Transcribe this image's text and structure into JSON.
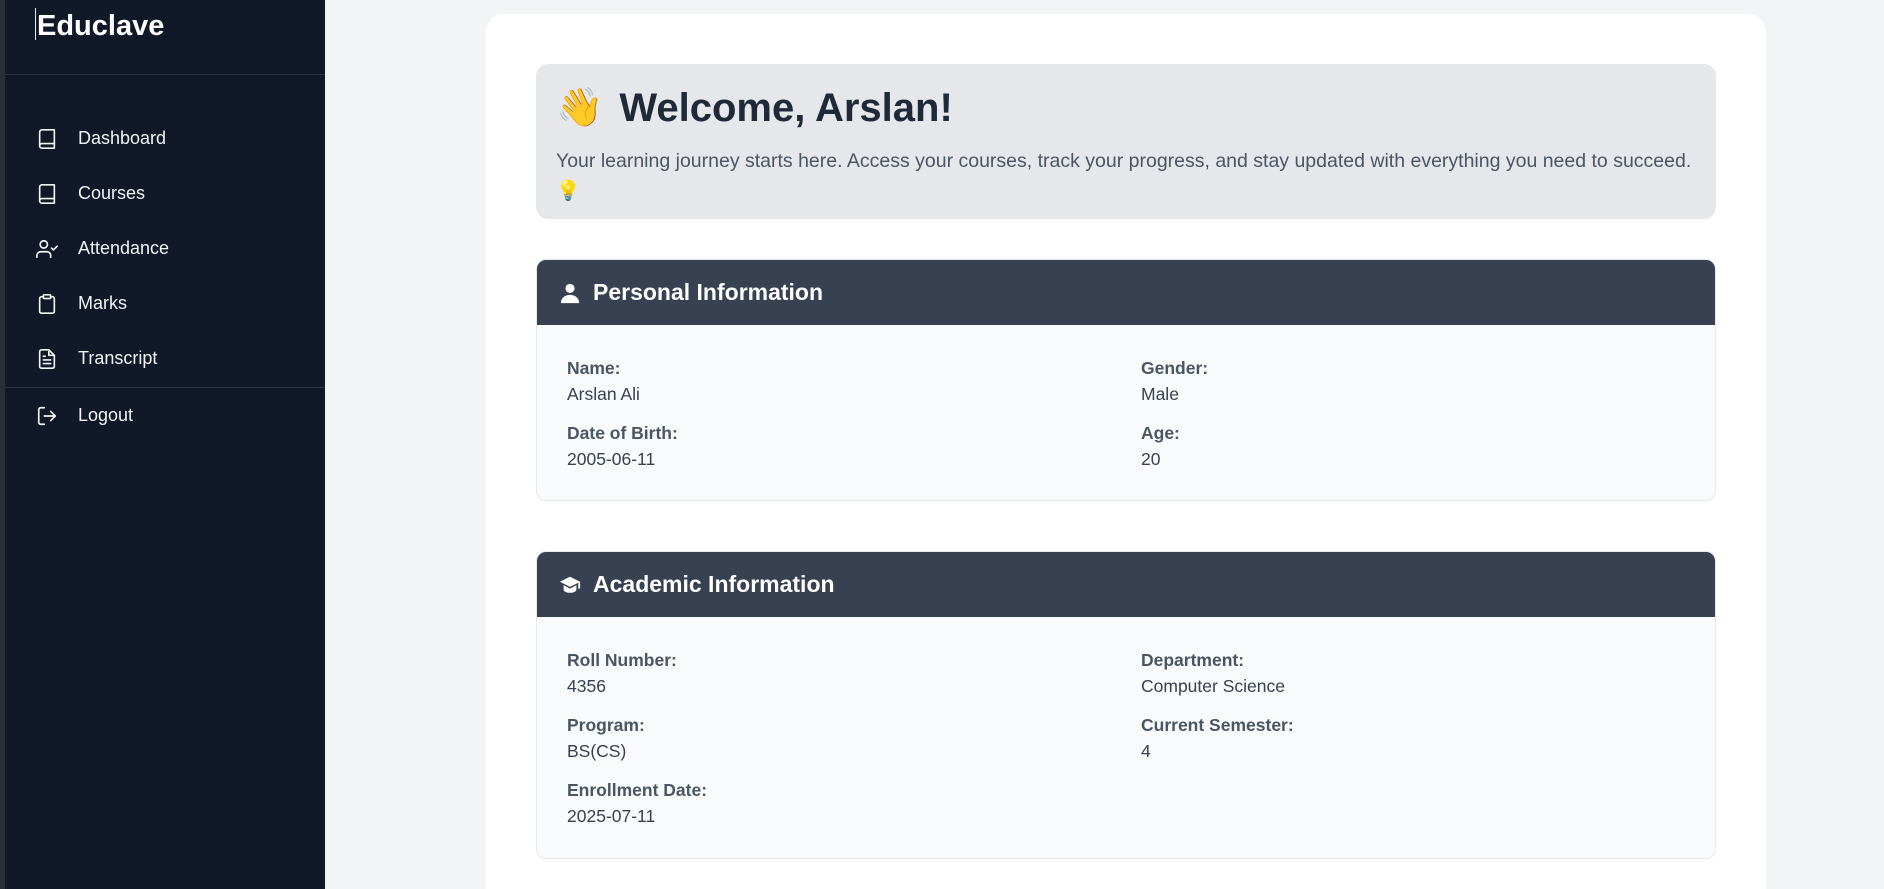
{
  "app": {
    "brand": "Educlave"
  },
  "sidebar": {
    "items": [
      {
        "label": "Dashboard",
        "icon": "book-icon"
      },
      {
        "label": "Courses",
        "icon": "book-icon"
      },
      {
        "label": "Attendance",
        "icon": "user-check-icon"
      },
      {
        "label": "Marks",
        "icon": "clipboard-icon"
      },
      {
        "label": "Transcript",
        "icon": "file-text-icon"
      }
    ],
    "logout": {
      "label": "Logout",
      "icon": "logout-icon"
    }
  },
  "welcome": {
    "emoji": "👋",
    "title": "Welcome, Arslan!",
    "text": "Your learning journey starts here. Access your courses, track your progress, and stay updated with everything you need to succeed.",
    "text_emoji": "💡"
  },
  "personal": {
    "title": "Personal Information",
    "icon": "user-icon",
    "fields": [
      {
        "label": "Name:",
        "value": "Arslan Ali"
      },
      {
        "label": "Gender:",
        "value": "Male"
      },
      {
        "label": "Date of Birth:",
        "value": "2005-06-11"
      },
      {
        "label": "Age:",
        "value": "20"
      }
    ]
  },
  "academic": {
    "title": "Academic Information",
    "icon": "graduation-cap-icon",
    "fields": [
      {
        "label": "Roll Number:",
        "value": "4356"
      },
      {
        "label": "Department:",
        "value": "Computer Science"
      },
      {
        "label": "Program:",
        "value": "BS(CS)"
      },
      {
        "label": "Current Semester:",
        "value": "4"
      },
      {
        "label": "Enrollment Date:",
        "value": "2025-07-11"
      }
    ]
  },
  "colors": {
    "sidebar_bg": "#111827",
    "section_header_bg": "#374151",
    "page_bg": "#f3f4f6"
  }
}
